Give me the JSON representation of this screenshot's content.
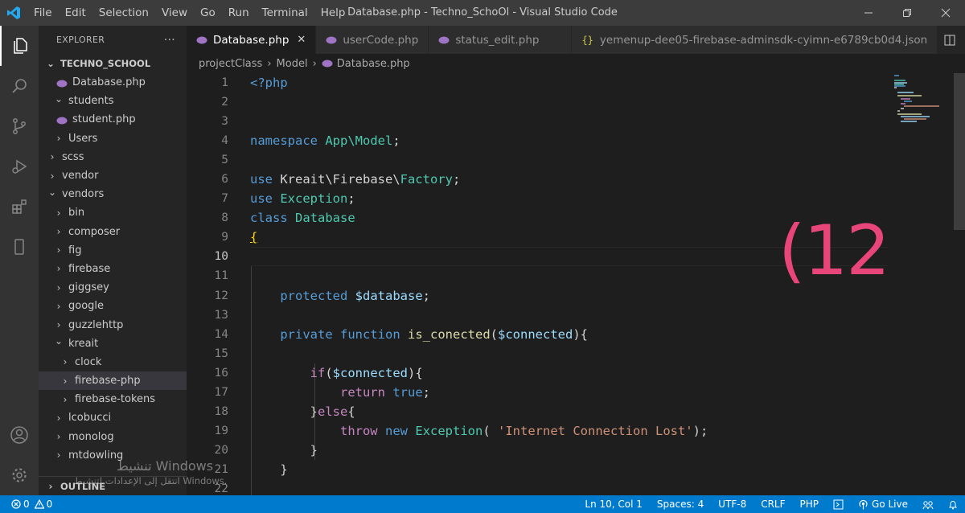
{
  "titlebar": {
    "menu": [
      "File",
      "Edit",
      "Selection",
      "View",
      "Go",
      "Run",
      "Terminal",
      "Help"
    ],
    "title": "Database.php - Techno_SchoOl - Visual Studio Code"
  },
  "sidebar": {
    "header": "EXPLORER",
    "more": "···",
    "project": "TECHNO_SCHOOL",
    "tree": [
      {
        "label": "Database.php",
        "type": "php"
      },
      {
        "label": "students",
        "type": "open"
      },
      {
        "label": "student.php",
        "type": "php"
      },
      {
        "label": "Users",
        "type": "closed"
      },
      {
        "label": "scss",
        "type": "closed"
      },
      {
        "label": "vendor",
        "type": "closed"
      },
      {
        "label": "vendors",
        "type": "open"
      },
      {
        "label": "bin",
        "type": "closed"
      },
      {
        "label": "composer",
        "type": "closed"
      },
      {
        "label": "fig",
        "type": "closed"
      },
      {
        "label": "firebase",
        "type": "closed"
      },
      {
        "label": "giggsey",
        "type": "closed"
      },
      {
        "label": "google",
        "type": "closed"
      },
      {
        "label": "guzzlehttp",
        "type": "closed"
      },
      {
        "label": "kreait",
        "type": "open"
      },
      {
        "label": "clock",
        "type": "closed"
      },
      {
        "label": "firebase-php",
        "type": "closed",
        "selected": true
      },
      {
        "label": "firebase-tokens",
        "type": "closed"
      },
      {
        "label": "lcobucci",
        "type": "closed"
      },
      {
        "label": "monolog",
        "type": "closed"
      },
      {
        "label": "mtdowling",
        "type": "closed"
      }
    ],
    "outline": "OUTLINE"
  },
  "tabs": [
    {
      "label": "Database.php",
      "kind": "php",
      "active": true
    },
    {
      "label": "userCode.php",
      "kind": "php"
    },
    {
      "label": "status_edit.php",
      "kind": "php"
    },
    {
      "label": "yemenup-dee05-firebase-adminsdk-cyimn-e6789cb0d4.json",
      "kind": "json"
    }
  ],
  "breadcrumb": [
    "projectClass",
    "Model",
    "Database.php"
  ],
  "editor": {
    "current_line": 10,
    "line_numbers": [
      "1",
      "2",
      "3",
      "4",
      "5",
      "6",
      "7",
      "8",
      "9",
      "10",
      "11",
      "12",
      "13",
      "14",
      "15",
      "16",
      "17",
      "18",
      "19",
      "20",
      "21",
      "22"
    ],
    "overlay": "(12)"
  },
  "watermark": {
    "line1": "تنشيط Windows",
    "line2": "انتقل إلى الإعدادات لتنشيط Windows."
  },
  "statusbar": {
    "errors": "0",
    "warnings": "0",
    "position": "Ln 10, Col 1",
    "spaces": "Spaces: 4",
    "encoding": "UTF-8",
    "eol": "CRLF",
    "language": "PHP",
    "golive": "Go Live"
  },
  "colors": {
    "accent": "#007acc",
    "overlay": "#e8457a",
    "php_icon": "#a074c4"
  }
}
